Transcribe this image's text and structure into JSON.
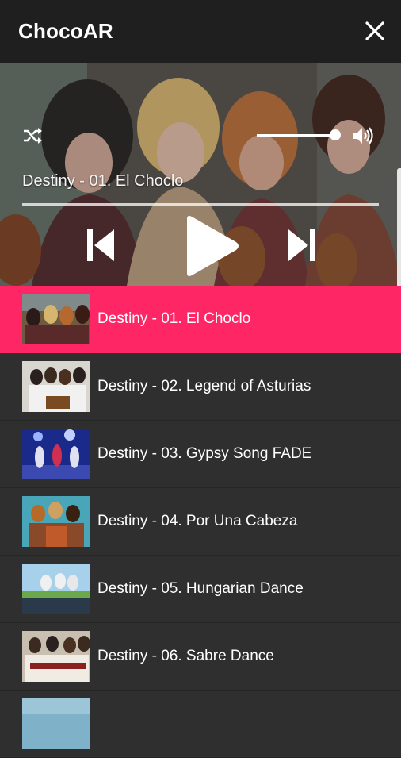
{
  "app": {
    "title": "ChocoAR",
    "close_icon": "close-icon"
  },
  "player": {
    "now_playing": "Destiny - 01. El Choclo",
    "volume_level": 1.0,
    "seek_progress": 0.0,
    "icons": {
      "shuffle": "shuffle-icon",
      "volume": "volume-icon",
      "previous": "skip-previous-icon",
      "play": "play-icon",
      "next": "skip-next-icon"
    }
  },
  "colors": {
    "app_bar": "#1f1f1f",
    "list_background": "#2f2f2f",
    "active_row": "#ff2666",
    "text": "#ffffff"
  },
  "tracks": [
    {
      "label": "Destiny - 01. El Choclo",
      "active": true
    },
    {
      "label": "Destiny - 02. Legend of Asturias",
      "active": false
    },
    {
      "label": "Destiny - 03. Gypsy Song FADE",
      "active": false
    },
    {
      "label": "Destiny - 04. Por Una Cabeza",
      "active": false
    },
    {
      "label": "Destiny - 05. Hungarian Dance",
      "active": false
    },
    {
      "label": "Destiny - 06. Sabre Dance",
      "active": false
    },
    {
      "label": "",
      "active": false
    }
  ]
}
